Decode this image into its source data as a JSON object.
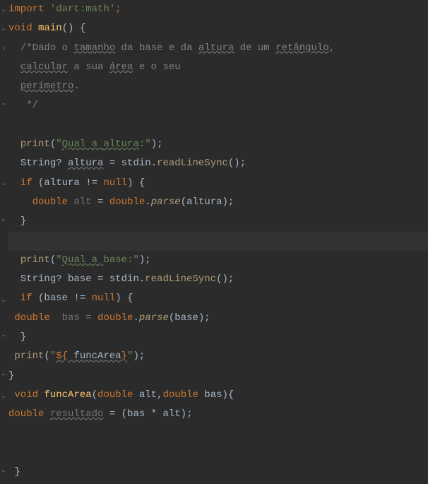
{
  "code": {
    "l1_import": "import",
    "l1_lib": "'dart:math'",
    "l1_semi": ";",
    "l2_void": "void",
    "l2_main": "main",
    "l2_parens": "() {",
    "l3_cmt_open": "/*",
    "l3_cmt_dado": "Dado o ",
    "l3_cmt_tamanho": "tamanho",
    "l3_cmt_dabase": " da base e da ",
    "l3_cmt_altura": "altura",
    "l3_cmt_deum": " de um ",
    "l3_cmt_retangulo": "retângulo",
    "l3_cmt_comma": ",",
    "l4_cmt_calcular": "calcular",
    "l4_cmt_asua": " a sua ",
    "l4_cmt_area": "área",
    "l4_cmt_eoseu": " e o seu",
    "l5_cmt_perimetro": "perímetro",
    "l5_cmt_dot": ".",
    "l6_cmt_close": "*/",
    "l8_print": "print",
    "l8_open": "(",
    "l8_str_open": "\"",
    "l8_str_quala": "Qual a ",
    "l8_str_altura": "altura",
    "l8_str_colon": ":",
    "l8_str_close": "\"",
    "l8_close": ");",
    "l9_string": "String?",
    "l9_altura": "altura",
    "l9_eq": " = stdin.",
    "l9_readline": "readLineSync",
    "l9_end": "();",
    "l10_if": "if",
    "l10_cond_open": " (altura != ",
    "l10_null": "null",
    "l10_cond_close": ") {",
    "l11_double": "double",
    "l11_alt": " alt",
    "l11_eq": " = ",
    "l11_double2": "double",
    "l11_dot": ".",
    "l11_parse": "parse",
    "l11_args": "(altura);",
    "l12_close": "}",
    "l14_print": "print",
    "l14_open": "(",
    "l14_str_open": "\"",
    "l14_str_quala": "Qual a ",
    "l14_str_base": "base",
    "l14_str_colon": ":",
    "l14_str_close": "\"",
    "l14_close": ");",
    "l15_string": "String?",
    "l15_base": " base = stdin.",
    "l15_readline": "readLineSync",
    "l15_end": "();",
    "l16_if": "if",
    "l16_cond_open": " (base != ",
    "l16_null": "null",
    "l16_cond_close": ") {",
    "l17_double": "double",
    "l17_bas": "  bas = ",
    "l17_double2": "double",
    "l17_dot": ".",
    "l17_parse": "parse",
    "l17_args": "(base);",
    "l18_close": "}",
    "l19_print": "print",
    "l19_open": "(",
    "l19_str_open": "\"",
    "l19_interp_open": "${",
    "l19_funcarea": " funcArea",
    "l19_interp_close": "}",
    "l19_str_close": "\"",
    "l19_close": ");",
    "l20_close": "}",
    "l21_void": "void",
    "l21_funcarea": "funcArea",
    "l21_sig_open": "(",
    "l21_double1": "double",
    "l21_alt": " alt,",
    "l21_double2": "double",
    "l21_bas": " bas){",
    "l22_double": "double",
    "l22_resultado": "resultado",
    "l22_expr": " = (bas * alt);",
    "l25_close": "}"
  },
  "gutter": {
    "fold_down": "⌄",
    "fold_up": "⌃",
    "fold_right": "›"
  }
}
